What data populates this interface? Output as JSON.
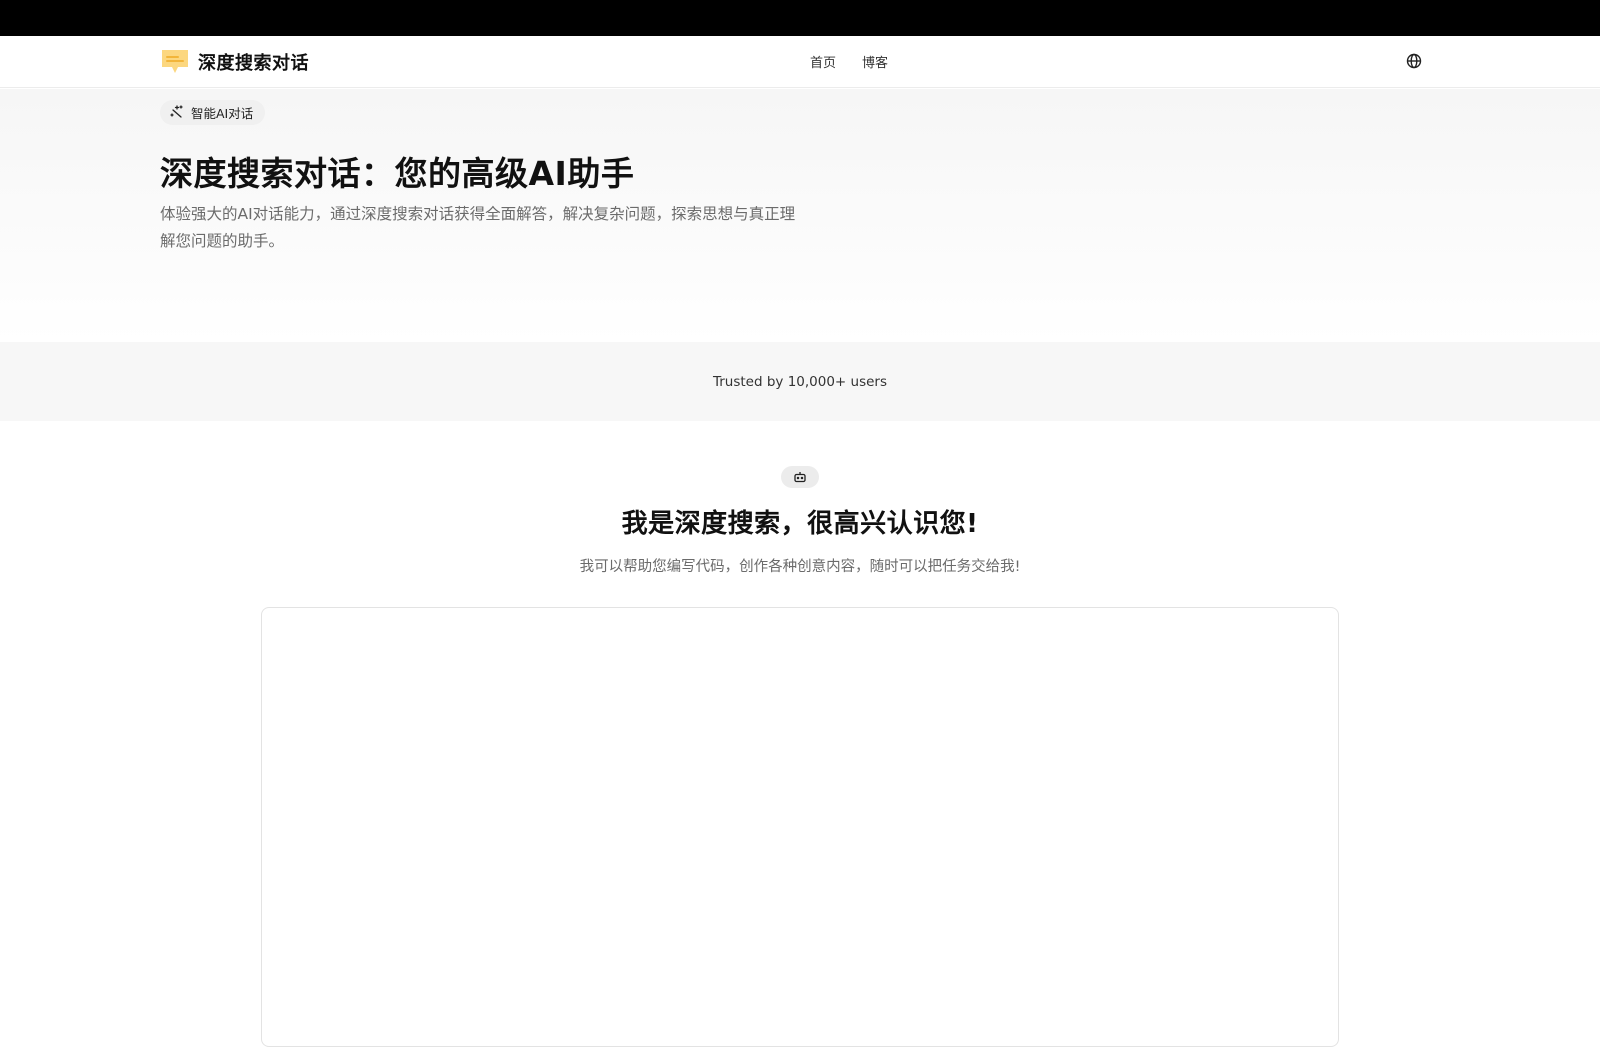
{
  "app": {
    "name": "深度搜索对话",
    "logo_icon": "chat-bubble-icon",
    "brand_color": "#fcd77f"
  },
  "nav": {
    "items": [
      {
        "label": "首页"
      },
      {
        "label": "博客"
      }
    ],
    "language_icon": "globe-icon"
  },
  "hero": {
    "badge_icon": "sparkles-icon",
    "badge_label": "智能AI对话",
    "title": "深度搜索对话：您的高级AI助手",
    "description": "体验强大的AI对话能力，通过深度搜索对话获得全面解答，解决复杂问题，探索思想与真正理解您问题的助手。"
  },
  "trusted": {
    "text": "Trusted by 10,000+ users"
  },
  "welcome": {
    "icon": "bot-icon",
    "title": "我是深度搜索，很高兴认识您!",
    "subtitle": "我可以帮助您编写代码，创作各种创意内容，随时可以把任务交给我!"
  }
}
